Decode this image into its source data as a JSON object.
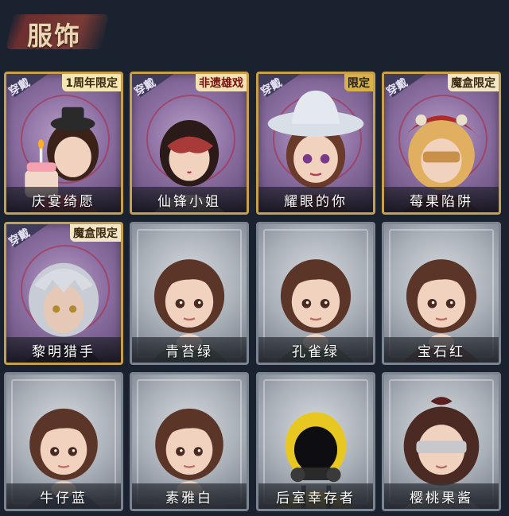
{
  "header": {
    "title": "服饰"
  },
  "labels": {
    "wear": "穿戴"
  },
  "colors": {
    "background": "#1a2230",
    "owned_frame": "#c8a04a",
    "owned_bg": "#8c6fa2",
    "locked_frame": "#7b8592",
    "title": "#e8d6b0"
  },
  "costumes": [
    {
      "name": "庆宴绮愿",
      "owned": true,
      "tag": "1周年限定",
      "icon": "cake-dress-portrait"
    },
    {
      "name": "仙锋小姐",
      "owned": true,
      "tag": "非遗雄戏",
      "icon": "mask-portrait"
    },
    {
      "name": "耀眼的你",
      "owned": true,
      "tag": "限定",
      "icon": "cowboy-hat-portrait"
    },
    {
      "name": "莓果陷阱",
      "owned": true,
      "tag": "魔盒限定",
      "icon": "berry-hood-portrait"
    },
    {
      "name": "黎明猎手",
      "owned": true,
      "tag": "魔盒限定",
      "icon": "silver-hair-portrait"
    },
    {
      "name": "青苔绿",
      "owned": false,
      "tag": "",
      "icon": "girl-green-portrait"
    },
    {
      "name": "孔雀绿",
      "owned": false,
      "tag": "",
      "icon": "girl-green-portrait"
    },
    {
      "name": "宝石红",
      "owned": false,
      "tag": "",
      "icon": "girl-red-portrait"
    },
    {
      "name": "牛仔蓝",
      "owned": false,
      "tag": "",
      "icon": "girl-blue-portrait"
    },
    {
      "name": "素雅白",
      "owned": false,
      "tag": "",
      "icon": "girl-white-portrait"
    },
    {
      "name": "后室幸存者",
      "owned": false,
      "tag": "",
      "icon": "hazmat-portrait"
    },
    {
      "name": "樱桃果酱",
      "owned": false,
      "tag": "",
      "icon": "blindfold-portrait"
    }
  ]
}
